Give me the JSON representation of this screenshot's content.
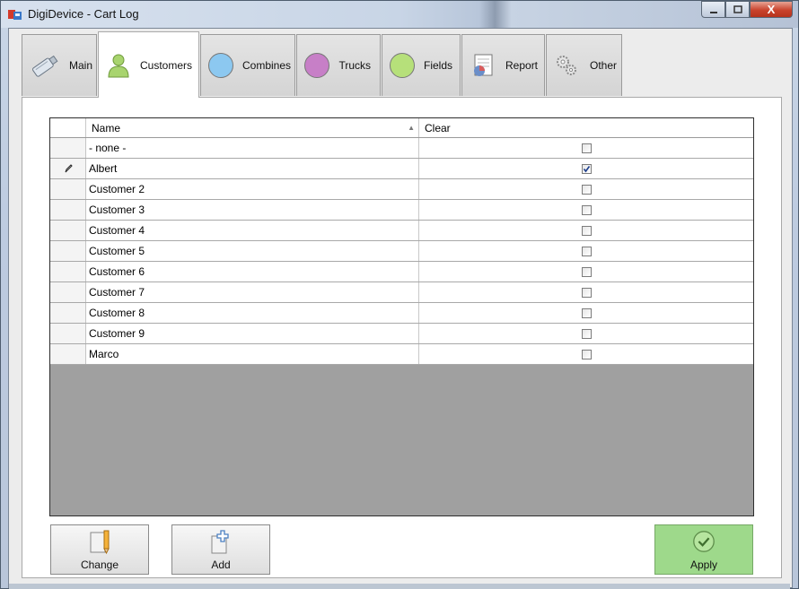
{
  "window": {
    "title": "DigiDevice - Cart Log",
    "minimize_label": "▭",
    "maximize_label": "▢",
    "close_label": "X"
  },
  "tabs": [
    {
      "label": "Main",
      "icon": "usb-drive-icon"
    },
    {
      "label": "Customers",
      "icon": "person-icon",
      "active": true
    },
    {
      "label": "Combines",
      "icon": "blue-circle-icon",
      "color": "#8cc8f0"
    },
    {
      "label": "Trucks",
      "icon": "purple-circle-icon",
      "color": "#c77fc7"
    },
    {
      "label": "Fields",
      "icon": "green-circle-icon",
      "color": "#b6e07a"
    },
    {
      "label": "Report",
      "icon": "report-icon"
    },
    {
      "label": "Other",
      "icon": "gears-icon"
    }
  ],
  "grid": {
    "columns": {
      "name": "Name",
      "clear": "Clear"
    },
    "rows": [
      {
        "name": "- none -",
        "clear": false
      },
      {
        "name": "Albert",
        "clear": true,
        "editing": true
      },
      {
        "name": "Customer 2",
        "clear": false
      },
      {
        "name": "Customer 3",
        "clear": false
      },
      {
        "name": "Customer 4",
        "clear": false
      },
      {
        "name": "Customer 5",
        "clear": false
      },
      {
        "name": "Customer 6",
        "clear": false
      },
      {
        "name": "Customer 7",
        "clear": false
      },
      {
        "name": "Customer 8",
        "clear": false
      },
      {
        "name": "Customer 9",
        "clear": false
      },
      {
        "name": "Marco",
        "clear": false
      }
    ]
  },
  "buttons": {
    "change": "Change",
    "add": "Add",
    "apply": "Apply"
  },
  "colors": {
    "apply_bg": "#9ed98b",
    "grid_empty": "#a0a0a0"
  }
}
